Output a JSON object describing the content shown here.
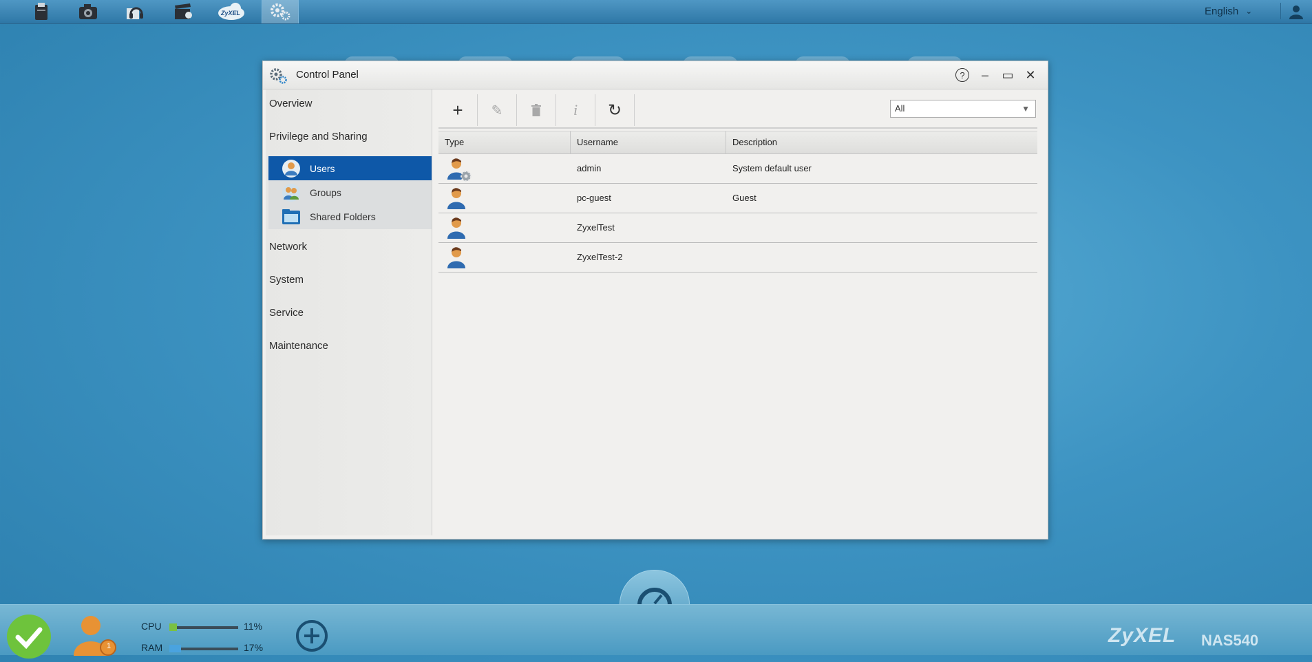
{
  "topbar": {
    "apps": [
      "file-browser",
      "photo",
      "music",
      "video",
      "zyxel-cloud",
      "control-panel"
    ],
    "zyxel_logo_text": "ZyXEL",
    "language": "English"
  },
  "window": {
    "title": "Control Panel",
    "help": "?",
    "minimize": "–",
    "maximize": "▭",
    "close": "✕"
  },
  "sidebar": {
    "overview": "Overview",
    "privilege": "Privilege and Sharing",
    "sub_items": [
      {
        "label": "Users"
      },
      {
        "label": "Groups"
      },
      {
        "label": "Shared Folders"
      }
    ],
    "network": "Network",
    "system": "System",
    "service": "Service",
    "maintenance": "Maintenance"
  },
  "toolbar": {
    "add": "+",
    "edit": "✎",
    "delete": "🗑",
    "info": "i",
    "refresh": "↻",
    "filter_value": "All"
  },
  "table": {
    "headers": [
      "Type",
      "Username",
      "Description"
    ],
    "rows": [
      {
        "type": "admin-user-icon",
        "username": "admin",
        "description": "System default user"
      },
      {
        "type": "user-icon",
        "username": "pc-guest",
        "description": "Guest"
      },
      {
        "type": "user-icon",
        "username": "ZyxelTest",
        "description": ""
      },
      {
        "type": "user-icon",
        "username": "ZyxelTest-2",
        "description": ""
      }
    ]
  },
  "bottom": {
    "users_badge": "1",
    "cpu_label": "CPU",
    "cpu_value": "11%",
    "ram_label": "RAM",
    "ram_value": "17%",
    "cpu_percent": 11,
    "ram_percent": 17,
    "brand": "ZyXEL",
    "model": "NAS540",
    "colors": {
      "cpu": "#7ac143",
      "ram": "#4aa3df",
      "ok": "#6ec33c"
    }
  }
}
